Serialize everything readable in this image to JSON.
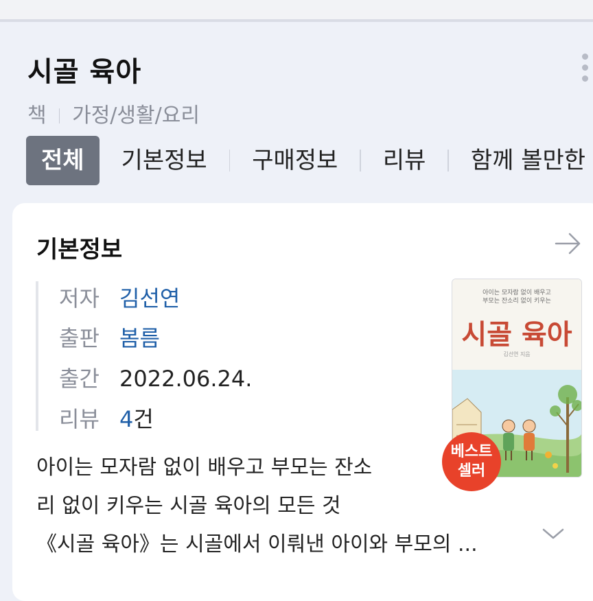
{
  "title": "시골 육아",
  "breadcrumb": {
    "category": "책",
    "subcategory": "가정/생활/요리"
  },
  "tabs": [
    {
      "label": "전체",
      "active": true
    },
    {
      "label": "기본정보",
      "active": false
    },
    {
      "label": "구매정보",
      "active": false
    },
    {
      "label": "리뷰",
      "active": false
    },
    {
      "label": "함께 볼만한",
      "active": false
    }
  ],
  "basic_info": {
    "heading": "기본정보",
    "rows": [
      {
        "label": "저자",
        "value": "김선연"
      },
      {
        "label": "출판",
        "value": "봄름"
      },
      {
        "label": "출간",
        "value": "2022.06.24."
      },
      {
        "label": "리뷰",
        "value_count": "4",
        "value_unit": "건"
      }
    ],
    "cover": {
      "tagline_1": "아이는 모자람 없이 배우고",
      "tagline_2": "부모는 잔소리 없이 키우는",
      "title": "시골 육아",
      "author": "김선연 지음"
    },
    "badge": {
      "line1": "베스트",
      "line2": "셀러"
    },
    "description": [
      "아이는 모자람 없이 배우고 부모는 잔소",
      "리 없이 키우는 시골 육아의 모든 것",
      "《시골 육아》는 시골에서 이뤄낸 아이와 부모의 ..."
    ]
  },
  "colors": {
    "page_bg": "#eef1f8",
    "active_tab": "#6d737f",
    "link": "#1f5fa8",
    "badge": "#e8422a"
  }
}
